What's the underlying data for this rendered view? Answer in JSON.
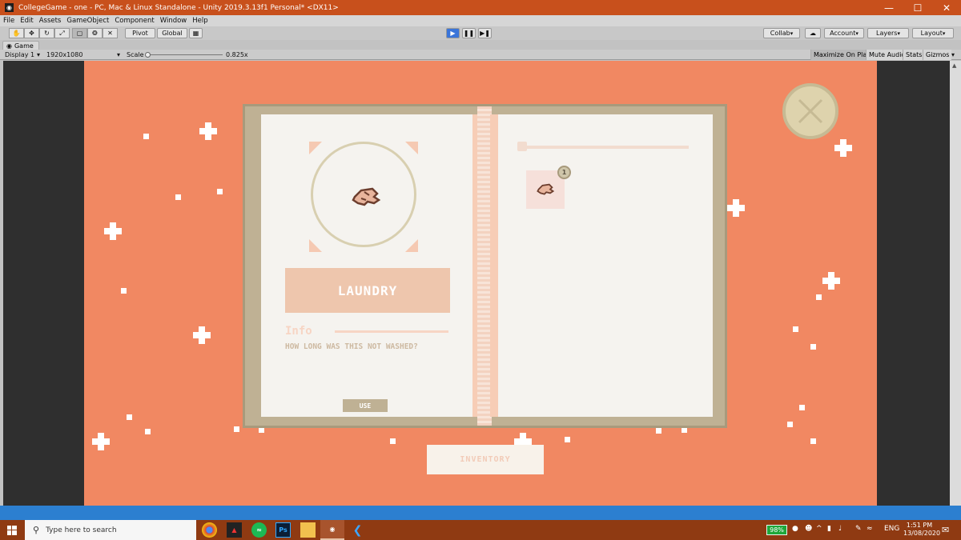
{
  "window": {
    "title": "CollegeGame - one - PC, Mac & Linux Standalone - Unity 2019.3.13f1 Personal* <DX11>",
    "minimize_glyph": "—",
    "maximize_glyph": "☐",
    "close_glyph": "✕"
  },
  "menu": [
    "File",
    "Edit",
    "Assets",
    "GameObject",
    "Component",
    "Window",
    "Help"
  ],
  "toolbar": {
    "pivot_label": "Pivot",
    "global_label": "Global",
    "collab_label": "Collab",
    "account_label": "Account",
    "layers_label": "Layers",
    "layout_label": "Layout"
  },
  "game_tab": {
    "label": "Game",
    "display": "Display 1",
    "resolution": "1920x1080",
    "scale_label": "Scale",
    "scale_value": "0.825x",
    "maximize_on_play": "Maximize On Play",
    "mute_audio": "Mute Audio",
    "stats": "Stats",
    "gizmos": "Gizmos"
  },
  "book": {
    "item_name": "LAUNDRY",
    "info_label": "Info",
    "description": "HOW LONG WAS THIS NOT WASHED?",
    "use_label": "USE",
    "slot_count": "1"
  },
  "inventory_label": "INVENTORY",
  "taskbar": {
    "search_placeholder": "Type here to search",
    "battery": "98%",
    "language": "ENG",
    "time": "1:51 PM",
    "date": "13/08/2020",
    "ps_label": "Ps"
  },
  "colors": {
    "game_background": "#f18862",
    "taskbar": "#8f3a12",
    "titlebar": "#c8501c"
  }
}
